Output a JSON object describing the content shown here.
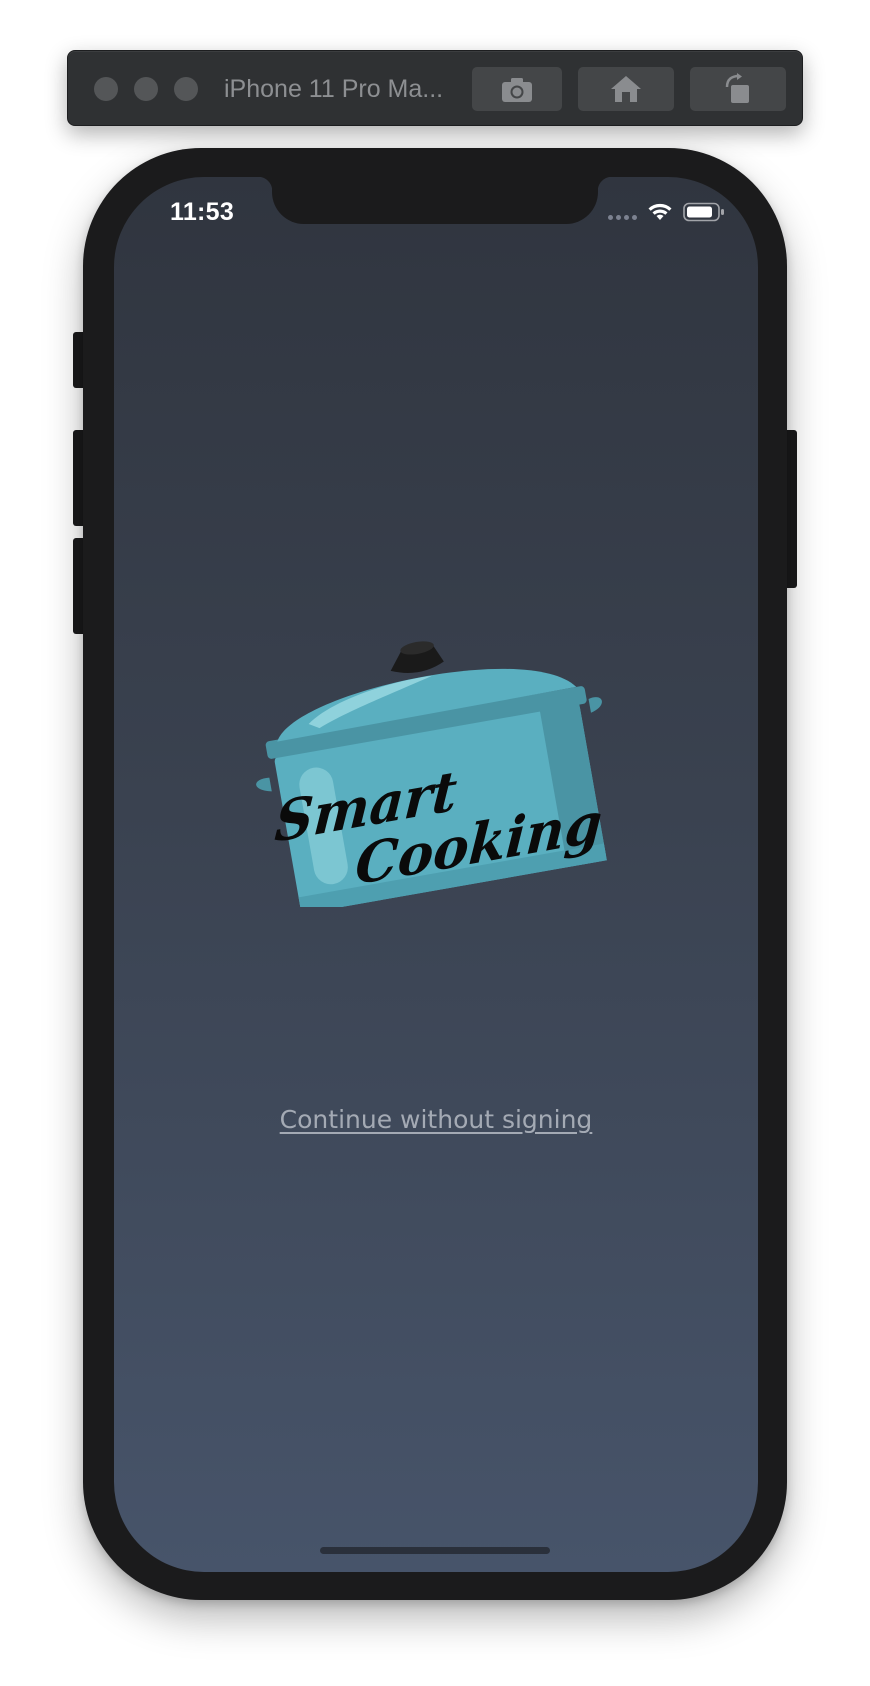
{
  "simulator": {
    "title": "iPhone 11 Pro Ma...",
    "toolbar_buttons": [
      {
        "icon": "camera-icon",
        "label": "Screenshot"
      },
      {
        "icon": "home-icon",
        "label": "Home"
      },
      {
        "icon": "rotate-icon",
        "label": "Rotate"
      }
    ]
  },
  "status_bar": {
    "time": "11:53",
    "icons": [
      "cellular-signal-icon",
      "wifi-icon",
      "battery-icon"
    ]
  },
  "app": {
    "logo": {
      "line1": "Smart",
      "line2": "Cooking",
      "colors": {
        "pot": "#5aafc0",
        "pot_dark": "#4a94a4",
        "lid_knob": "#1a1a1a",
        "text": "#0a0a0a"
      }
    },
    "continue_link": "Continue without signing"
  },
  "colors": {
    "screen_top": "#30353f",
    "screen_bottom": "#47546a",
    "link": "#a4aab4"
  }
}
